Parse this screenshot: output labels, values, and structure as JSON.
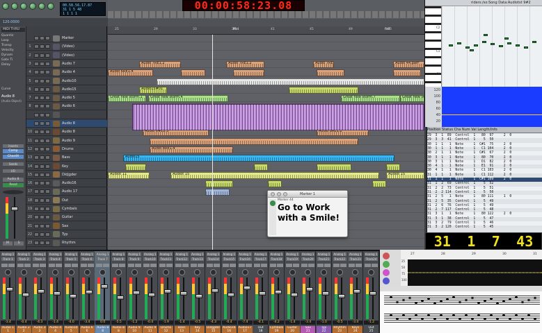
{
  "transport": {
    "lcd_lines": [
      "00.58.56.17.87",
      "31  1  5  48",
      "1  1  1  1",
      "1  1  1  1"
    ],
    "tempo": "120.0000",
    "big_time": "00:00:58:23.08"
  },
  "inspector": {
    "header": "MIDI THRU",
    "rows": [
      "Quantiz",
      "Loop",
      "Transp",
      "Velocity",
      "Dynam",
      "Gate Ti",
      "Delay"
    ],
    "section2": "Curve",
    "section3": "Audio 8",
    "section3b": "(Audio Object)",
    "btn_inserts": "Inserts",
    "btn_comp": "Comp",
    "btn_chord": "ChordX",
    "btn_sends": "Sends",
    "btn_i_o": "I/O",
    "btn_audio": "Audio 8",
    "btn_read": "Read",
    "btn_m": "M",
    "btn_s": "S"
  },
  "arrange": {
    "marker_lane": "Marker",
    "ruler_labels": [
      "25",
      "29",
      "33",
      "37",
      "41",
      "45",
      "49",
      "53"
    ],
    "ruler_marks": [
      "Mid",
      "Ref"
    ],
    "tracks": [
      {
        "n": "",
        "name": "Marker"
      },
      {
        "n": "1",
        "name": "(Video)"
      },
      {
        "n": "2",
        "name": "(Video)"
      },
      {
        "n": "3",
        "name": "Audio 7"
      },
      {
        "n": "4",
        "name": "Audio 4"
      },
      {
        "n": "5",
        "name": "Audio10"
      },
      {
        "n": "6",
        "name": "Audio15"
      },
      {
        "n": "7",
        "name": "Audio 5"
      },
      {
        "n": "8",
        "name": "Audio 6"
      },
      {
        "n": "",
        "name": ""
      },
      {
        "n": "",
        "name": "Audio 8"
      },
      {
        "n": "10",
        "name": "Audio 8"
      },
      {
        "n": "11",
        "name": "Audio 9"
      },
      {
        "n": "12",
        "name": "Drums"
      },
      {
        "n": "13",
        "name": "Bass"
      },
      {
        "n": "14",
        "name": "Key"
      },
      {
        "n": "15",
        "name": "Didjgder"
      },
      {
        "n": "16",
        "name": "Audio16"
      },
      {
        "n": "17",
        "name": "Audio 17"
      },
      {
        "n": "18",
        "name": "Out"
      },
      {
        "n": "19",
        "name": "Cymbals"
      },
      {
        "n": "20",
        "name": "Guitar"
      },
      {
        "n": "21",
        "name": "Sax"
      },
      {
        "n": "22",
        "name": "Typ"
      },
      {
        "n": "23",
        "name": "Rhythm"
      }
    ],
    "region_labels": {
      "r1": "Audio 7RE1.2",
      "r2": "Audio 7RE1.2",
      "r3": "Audio 7RE1.2",
      "r4": "Audio 44.parF",
      "r5": "Audio 6RE1.4",
      "r6": "Audio15#01",
      "r7": "Great new storm.1",
      "r8": "Great new storm.4",
      "r9": "Great new storm.7",
      "r10": "Great new storm.6",
      "r11": "Audio 6#E1.4",
      "r12": "Audio 6#E2.3",
      "r13": "Audio 8RE1.2",
      "r14": "Audio 8RE1.4",
      "r15": "Audio 9",
      "r16": "Audio 8001.1",
      "r17": "Audio15",
      "r18": "Audiot 11",
      "r19": "Audiot 15",
      "r20": "Audiot 15",
      "r21": "Audiot 11"
    }
  },
  "piano": {
    "title": "riders:/so:Song Data:Audiotst 9#2",
    "key_c3": "C3",
    "key_c2": "C2",
    "key_c1": "C1",
    "key_c0": "C0",
    "vel_labels": [
      "120",
      "100",
      "80",
      "60",
      "40",
      "20"
    ]
  },
  "events": {
    "header": "Position          Status   Cha   Num  Val  Length/Info",
    "rows": [
      "29  3  1  89  Control  1   80  97     2  0",
      "29  3  3  41  Control  1    5  50",
      "30  1  1   1  Note     1  C#1  75     2  0",
      "30  1  1   1  Note     1   C1 104     2  0",
      "30  2  1   1  Note     1  C#1  67     2  0",
      "30  3  1   1  Note     1   80  70     2  0",
      "30  3  1   1  Note     1   D1  82     2  0",
      "30  4  1   1  Note     1   E1  91     2  0",
      "30  4  1   1  Note     1   C1 103     2  0",
      "31  1  1   1  Note     1   C1 112     2  0",
      "31  1  1   1  Note     1  C#1 109     2  0",
      "31  1  2  69  Control  1    5  52",
      "31  2  2  73  Control  1    5  51",
      "31  2  2 114  Control  1    5  50",
      "31  2  5   1  Note     1   80 111     1  0",
      "31  2  5  35  Control  1    5  49",
      "31  2  6  76  Control  1    5  49",
      "31  2  7 117  Control  1    5  48",
      "31  3  1   1  Note     1   80 122     2  0",
      "31  3  1  38  Control  1    5  47",
      "31  3  2  79  Control  1    5  46",
      "31  3  2 120  Control  1    5  45"
    ]
  },
  "position_lcd": [
    "31",
    "1",
    "7",
    "43"
  ],
  "marker": {
    "title": "Marker 1",
    "sub": "Marker 44",
    "text_line1": "Go to Work",
    "text_line2": "with a Smile!"
  },
  "mixer": {
    "strips": [
      {
        "ins": "Analog 1",
        "ins2": "Track 1",
        "val": "-3.4",
        "label": "Audio 1",
        "num": "1"
      },
      {
        "ins": "Analog 1",
        "ins2": "Track 2",
        "val": "-0.4",
        "label": "Audio 2",
        "num": "2"
      },
      {
        "ins": "Analog 1",
        "ins2": "Track 3",
        "val": "-4.3",
        "label": "Audio 3",
        "num": "3"
      },
      {
        "ins": "Analog 1",
        "ins2": "Track 4",
        "val": "-1.4",
        "label": "Audio 4",
        "num": "4"
      },
      {
        "ins": "Analog 1",
        "ins2": "Track 5",
        "val": "-4.0",
        "label": "Audio10",
        "num": "5"
      },
      {
        "ins": "Analog 1",
        "ins2": "Track 6",
        "val": "-3.4",
        "label": "Audio 6",
        "num": "6"
      },
      {
        "ins": "Analog 1",
        "ins2": "Track 7",
        "val": "0.0",
        "label": "Audio 8",
        "num": "8"
      },
      {
        "ins": "Analog 1",
        "ins2": "Track 8",
        "val": "-5.5",
        "label": "Audio 8",
        "num": "8"
      },
      {
        "ins": "Analog 1",
        "ins2": "Track 9",
        "val": "-1.2",
        "label": "Audio 9",
        "num": "10"
      },
      {
        "ins": "Analog 1",
        "ins2": "Track10",
        "val": "-0.4",
        "label": "Audio 9",
        "num": "11"
      },
      {
        "ins": "Analog 1",
        "ins2": "Track11",
        "val": "-1.9",
        "label": "Drums",
        "num": "12"
      },
      {
        "ins": "Analog 1",
        "ins2": "Track12",
        "val": "-1.4",
        "label": "Bass",
        "num": "13"
      },
      {
        "ins": "Analog 1",
        "ins2": "Track13",
        "val": "-0.5",
        "label": "Key",
        "num": "14"
      },
      {
        "ins": "Analog 1",
        "ins2": "Track14",
        "val": "-4.3",
        "label": "Didjgder",
        "num": "15"
      },
      {
        "ins": "Analog 1",
        "ins2": "Track15",
        "val": "-0.4",
        "label": "Audio16",
        "num": "16"
      },
      {
        "ins": "Analog 1",
        "ins2": "Track16",
        "val": "-7.4",
        "label": "Audio17",
        "num": "17"
      },
      {
        "ins": "Analog 1",
        "ins2": "Track17",
        "val": "-4.1",
        "label": "Out",
        "num": "18"
      },
      {
        "ins": "Analog 1",
        "ins2": "Track18",
        "val": "-4.2",
        "label": "Cymbals",
        "num": "19"
      },
      {
        "ins": "Analog 1",
        "ins2": "Track19",
        "val": "-1.4",
        "label": "Guitar",
        "num": "20"
      },
      {
        "ins": "Analog 1",
        "ins2": "Track20",
        "val": "-3.4",
        "label": "Sax",
        "num": "21"
      },
      {
        "ins": "Analog 1",
        "ins2": "Track21",
        "val": "-1.0",
        "label": "Typ",
        "num": "22"
      },
      {
        "ins": "Analog 1",
        "ins2": "Track22",
        "val": "-0.5",
        "label": "Rhythm",
        "num": "23"
      },
      {
        "ins": "Analog 1",
        "ins2": "Track23",
        "val": "-3.4",
        "label": "Keys",
        "num": "24"
      },
      {
        "ins": "Analog 1",
        "ins2": "Track24",
        "val": "-1.2",
        "label": "Out",
        "num": "25"
      }
    ]
  },
  "wave": {
    "scale": [
      "25",
      "50",
      "75",
      "100"
    ],
    "ruler": [
      "27",
      "28",
      "29",
      "30",
      "31"
    ]
  }
}
